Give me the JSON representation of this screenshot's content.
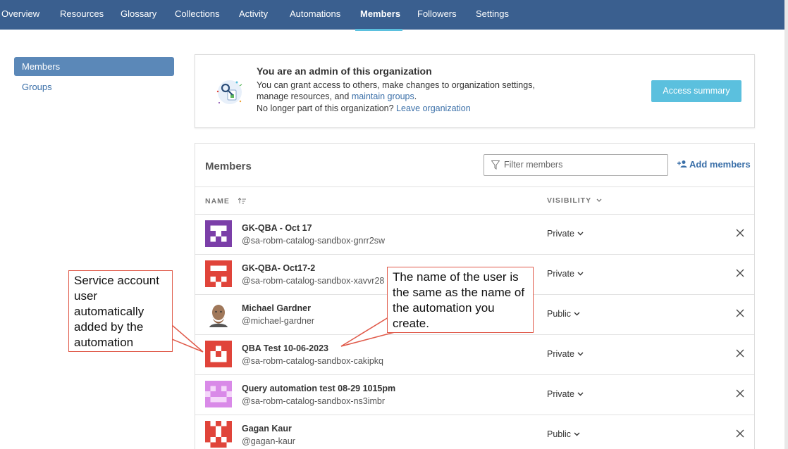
{
  "nav": {
    "tabs": [
      "Overview",
      "Resources",
      "Glossary",
      "Collections",
      "Activity",
      "Automations",
      "Members",
      "Followers",
      "Settings"
    ],
    "active_tab": "Members"
  },
  "subnav": {
    "items": [
      "Members",
      "Groups"
    ],
    "active": "Members"
  },
  "admin": {
    "title": "You are an admin of this organization",
    "line1": "You can grant access to others, make changes to organization settings,",
    "line2_prefix": "manage resources, and ",
    "line2_link": "maintain groups",
    "line2_suffix": ".",
    "line3_prefix": "No longer part of this organization? ",
    "line3_link": "Leave organization",
    "button": "Access summary"
  },
  "members": {
    "title": "Members",
    "filter_placeholder": "Filter members",
    "add_label": "Add members",
    "col_name": "NAME",
    "col_visibility": "VISIBILITY",
    "rows": [
      {
        "name": "GK-QBA - Oct 17",
        "handle": "@sa-robm-catalog-sandbox-gnrr2sw",
        "visibility": "Private",
        "avatar_color": "#7b3fa8"
      },
      {
        "name": "GK-QBA- Oct17-2",
        "handle": "@sa-robm-catalog-sandbox-xavvr28",
        "visibility": "Private",
        "avatar_color": "#e0443a"
      },
      {
        "name": "Michael Gardner",
        "handle": "@michael-gardner",
        "visibility": "Public",
        "avatar_color": "#a0785a"
      },
      {
        "name": "QBA Test 10-06-2023",
        "handle": "@sa-robm-catalog-sandbox-cakipkq",
        "visibility": "Private",
        "avatar_color": "#e0443a"
      },
      {
        "name": "Query automation test 08-29 1015pm",
        "handle": "@sa-robm-catalog-sandbox-ns3imbr",
        "visibility": "Private",
        "avatar_color": "#d98ae8"
      },
      {
        "name": "Gagan Kaur",
        "handle": "@gagan-kaur",
        "visibility": "Public",
        "avatar_color": "#e0443a"
      }
    ]
  },
  "callouts": {
    "left": "Service account user automatically added by the automation",
    "right": "The name of the user is the same as the name of the automation you create."
  },
  "colors": {
    "nav_bg": "#3a5f8f",
    "accent": "#5bc0de",
    "link": "#3a6fa8",
    "callout_border": "#e05a4a"
  }
}
